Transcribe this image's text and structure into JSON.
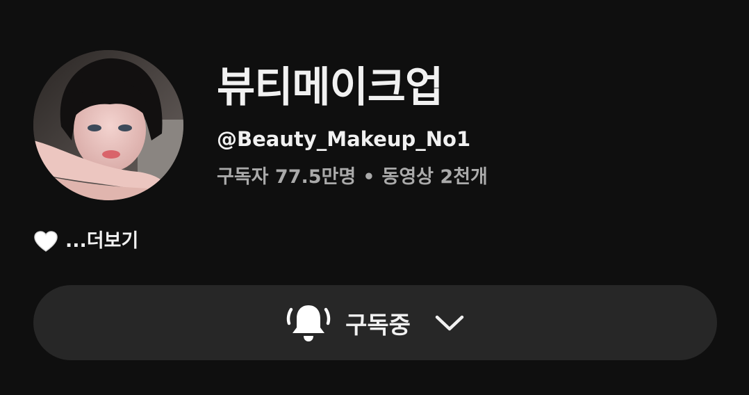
{
  "channel": {
    "name": "뷰티메이크업",
    "handle": "@Beauty_Makeup_No1",
    "subscribers": "구독자 77.5만명",
    "separator": "•",
    "videos": "동영상 2천개"
  },
  "description": {
    "icon": "white-heart-icon",
    "more_label": "...더보기"
  },
  "subscribe_button": {
    "label": "구독중",
    "bell_icon": "notification-bell-ringing-icon",
    "chevron_icon": "chevron-down-icon"
  },
  "colors": {
    "background": "#0f0f0f",
    "button_bg": "#272727",
    "primary_text": "#f1f1f1",
    "secondary_text": "#aaaaaa"
  }
}
